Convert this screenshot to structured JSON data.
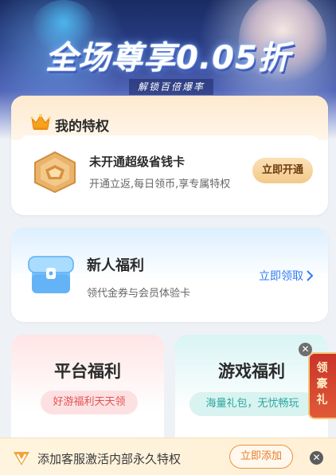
{
  "banner": {
    "title": "全场尊享0.05折",
    "subtitle": "解锁百倍爆率"
  },
  "privilege": {
    "title": "我的特权",
    "card_title": "未开通超级省钱卡",
    "card_desc": "开通立返,每日领币,享专属特权",
    "button": "立即开通"
  },
  "newbie": {
    "title": "新人福利",
    "desc": "领代金券与会员体验卡",
    "link": "立即领取"
  },
  "platform": {
    "title": "平台福利",
    "tag": "好游福利天天领"
  },
  "game": {
    "title": "游戏福利",
    "tag": "海量礼包，无忧畅玩"
  },
  "float_gift": {
    "label": "领豪礼"
  },
  "bottom_bar": {
    "text": "添加客服激活内部永久特权",
    "button": "立即添加"
  },
  "icons": {
    "crown": "crown-icon",
    "medal": "medal-icon",
    "chest": "treasure-chest-icon",
    "vip": "vip-icon",
    "close": "close-icon",
    "chevron": "chevron-right-icon"
  },
  "colors": {
    "accent_blue": "#2f7cf6",
    "gold_button": "#f3c989",
    "pink_tag": "#e35254",
    "teal_tag": "#2aa6a0",
    "orange_button": "#ea7b26"
  }
}
